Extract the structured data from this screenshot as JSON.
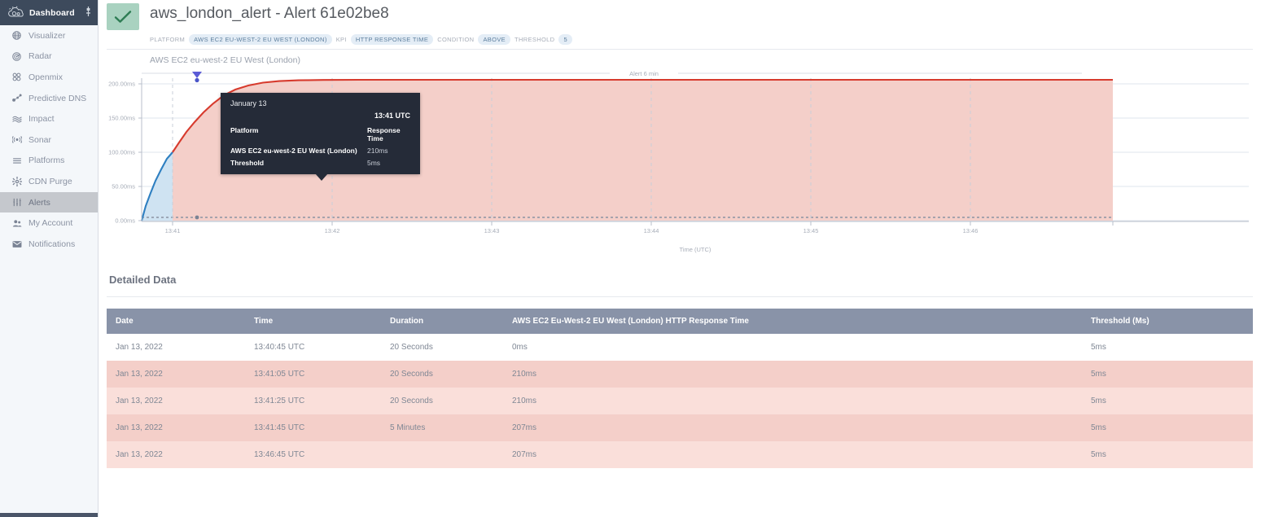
{
  "sidebar": {
    "header": {
      "title": "Dashboard",
      "logo_icon": "cloud-logo-icon",
      "pin_icon": "pin-icon"
    },
    "items": [
      {
        "label": "Visualizer",
        "icon": "globe-icon",
        "active": false
      },
      {
        "label": "Radar",
        "icon": "radar-icon",
        "active": false
      },
      {
        "label": "Openmix",
        "icon": "grid-circles-icon",
        "active": false
      },
      {
        "label": "Predictive DNS",
        "icon": "nodes-icon",
        "active": false
      },
      {
        "label": "Impact",
        "icon": "waves-icon",
        "active": false
      },
      {
        "label": "Sonar",
        "icon": "sonar-icon",
        "active": false
      },
      {
        "label": "Platforms",
        "icon": "list-lines-icon",
        "active": false
      },
      {
        "label": "CDN Purge",
        "icon": "gear-icon",
        "active": false
      },
      {
        "label": "Alerts",
        "icon": "sliders-icon",
        "active": true
      },
      {
        "label": "My Account",
        "icon": "people-icon",
        "active": false
      },
      {
        "label": "Notifications",
        "icon": "envelope-icon",
        "active": false
      }
    ]
  },
  "header": {
    "status_icon": "green-check-icon",
    "title": "aws_london_alert - Alert 61e02be8",
    "subtitle": "AWS EC2 eu-west-2 EU West (London)",
    "badges": [
      {
        "key": "PLATFORM",
        "value": "AWS EC2 EU-WEST-2 EU WEST (LONDON)"
      },
      {
        "key": "KPI",
        "value": "HTTP RESPONSE TIME"
      },
      {
        "key": "CONDITION",
        "value": "ABOVE"
      },
      {
        "key": "THRESHOLD",
        "value": "5"
      }
    ]
  },
  "chart_data": {
    "type": "area",
    "title": "",
    "xlabel": "Time (UTC)",
    "ylabel": "",
    "xtick_labels": [
      "13:41",
      "13:42",
      "13:43",
      "13:44",
      "13:45",
      "13:46"
    ],
    "ytick_labels": [
      "0.00ms",
      "50.00ms",
      "100.00ms",
      "150.00ms",
      "200.00ms"
    ],
    "ylim": [
      0,
      215
    ],
    "grid": true,
    "legend": "none",
    "annotation": {
      "label": "Alert 6 min",
      "start": "13:41:05",
      "end": "13:46:45"
    },
    "series": [
      {
        "name": "AWS EC2 eu-west-2 EU West (London) HTTP Response Time",
        "color": "#c0392b",
        "normal_color": "#2e7fc1",
        "fill_alert": "#f4cfc9",
        "fill_normal": "#cfe3f2",
        "points": [
          {
            "t": "13:40:45",
            "v": 0
          },
          {
            "t": "13:40:52",
            "v": 52
          },
          {
            "t": "13:40:58",
            "v": 100
          },
          {
            "t": "13:41:05",
            "v": 138
          },
          {
            "t": "13:41:12",
            "v": 172
          },
          {
            "t": "13:41:20",
            "v": 192
          },
          {
            "t": "13:41:25",
            "v": 203
          },
          {
            "t": "13:41:35",
            "v": 208
          },
          {
            "t": "13:41:45",
            "v": 210
          },
          {
            "t": "13:46:45",
            "v": 207
          }
        ]
      },
      {
        "name": "Threshold",
        "color": "#8b93a3",
        "style": "dotted",
        "value": 5
      }
    ],
    "hover_marker": {
      "t": "13:41",
      "v": 210
    }
  },
  "tooltip": {
    "date": "January 13",
    "time": "13:41 UTC",
    "header_left": "Platform",
    "header_right": "Response Time",
    "rows": [
      {
        "label": "AWS EC2 eu-west-2 EU West (London)",
        "value": "210ms"
      },
      {
        "label": "Threshold",
        "value": "5ms"
      }
    ]
  },
  "detailed": {
    "title": "Detailed Data",
    "columns": [
      "Date",
      "Time",
      "Duration",
      "AWS EC2 Eu-West-2 EU West (London) HTTP Response Time",
      "Threshold (Ms)"
    ],
    "rows": [
      {
        "date": "Jan 13, 2022",
        "time": "13:40:45 UTC",
        "duration": "20 Seconds",
        "value": "0ms",
        "threshold": "5ms",
        "state": "plain"
      },
      {
        "date": "Jan 13, 2022",
        "time": "13:41:05 UTC",
        "duration": "20 Seconds",
        "value": "210ms",
        "threshold": "5ms",
        "state": "alert-dark"
      },
      {
        "date": "Jan 13, 2022",
        "time": "13:41:25 UTC",
        "duration": "20 Seconds",
        "value": "210ms",
        "threshold": "5ms",
        "state": "alert-light"
      },
      {
        "date": "Jan 13, 2022",
        "time": "13:41:45 UTC",
        "duration": "5 Minutes",
        "value": "207ms",
        "threshold": "5ms",
        "state": "alert-dark"
      },
      {
        "date": "Jan 13, 2022",
        "time": "13:46:45 UTC",
        "duration": "",
        "value": "207ms",
        "threshold": "5ms",
        "state": "alert-light"
      }
    ]
  }
}
